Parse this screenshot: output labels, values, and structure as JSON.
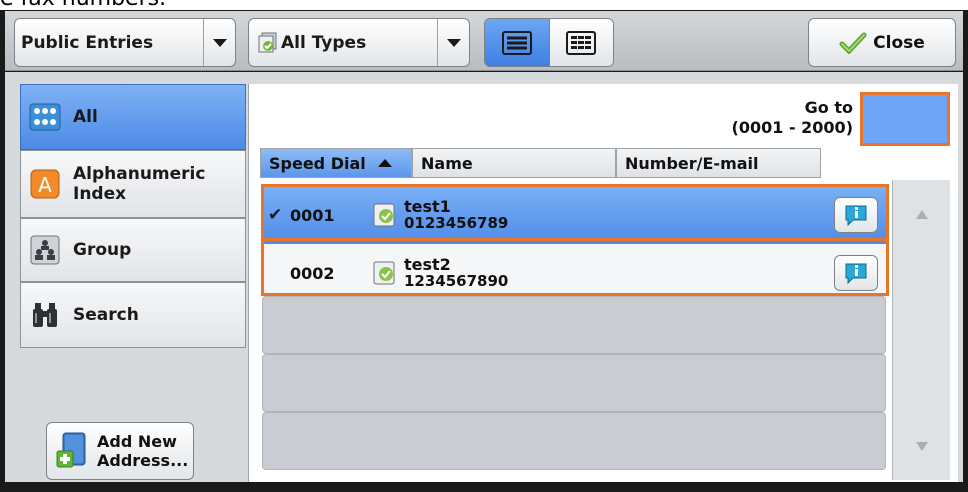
{
  "caption": "e fax numbers.",
  "toolbar": {
    "entries_dropdown": "Public Entries",
    "types_dropdown": "All Types",
    "close_label": "Close"
  },
  "sidebar": {
    "tabs": [
      {
        "label": "All",
        "icon": "address-book-icon",
        "active": true
      },
      {
        "label": "Alphanumeric\nIndex",
        "icon": "letter-a-icon",
        "active": false
      },
      {
        "label": "Group",
        "icon": "group-icon",
        "active": false
      },
      {
        "label": "Search",
        "icon": "binoculars-icon",
        "active": false
      }
    ],
    "add_new": "Add New\nAddress..."
  },
  "goto": {
    "label": "Go to\n(0001 - 2000)"
  },
  "table": {
    "columns": [
      "Speed Dial",
      "Name",
      "Number/E-mail"
    ],
    "rows": [
      {
        "speed_dial": "0001",
        "name": "test1",
        "number": "0123456789",
        "checked": true
      },
      {
        "speed_dial": "0002",
        "name": "test2",
        "number": "1234567890",
        "checked": false
      }
    ]
  },
  "colors": {
    "accent": "#4f8be7",
    "highlight": "#e7762b"
  }
}
